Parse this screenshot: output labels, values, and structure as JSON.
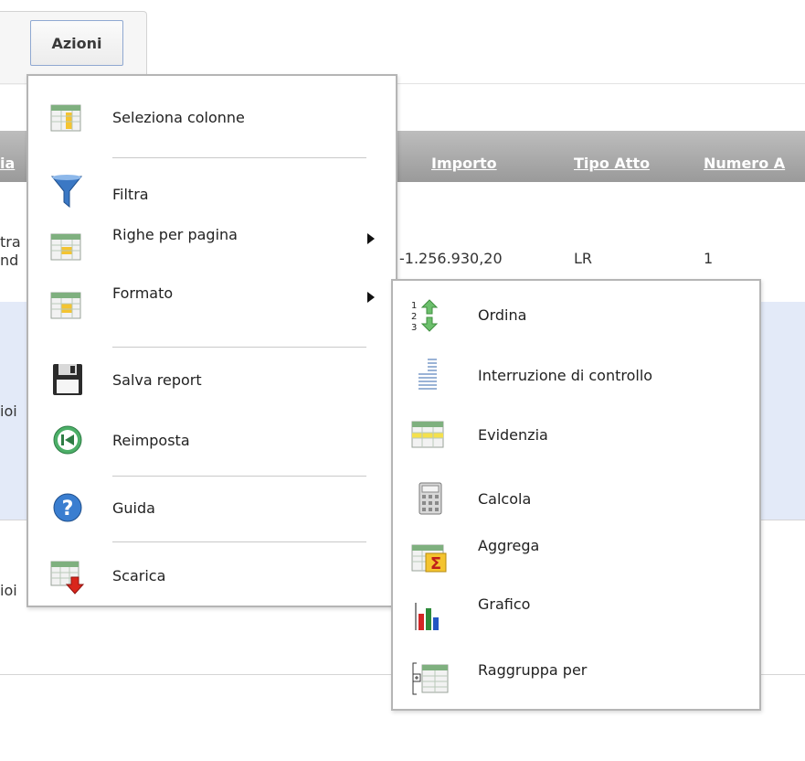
{
  "toolbar": {
    "actions_label": "Azioni"
  },
  "table": {
    "headers": [
      "ia",
      "Importo",
      "Tipo Atto",
      "Numero A"
    ],
    "row1": {
      "left_line1": "tra",
      "left_line2": "nd",
      "importo": "-1.256.930,20",
      "tipo_atto": "LR",
      "numero": "1"
    },
    "row2": {
      "left": "ioi"
    },
    "row3": {
      "left": "ioi"
    }
  },
  "actions_menu": {
    "items": [
      {
        "label": "Seleziona colonne",
        "icon": "columns-icon"
      },
      {
        "label": "Filtra",
        "icon": "funnel-icon"
      },
      {
        "label": "Righe per pagina",
        "icon": "rows-table-icon",
        "submenu": true
      },
      {
        "label": "Formato",
        "icon": "format-table-icon",
        "submenu": true
      },
      {
        "label": "Salva report",
        "icon": "floppy-disk-icon"
      },
      {
        "label": "Reimposta",
        "icon": "reset-icon"
      },
      {
        "label": "Guida",
        "icon": "help-icon"
      },
      {
        "label": "Scarica",
        "icon": "download-icon"
      }
    ]
  },
  "format_submenu": {
    "items": [
      {
        "label": "Ordina",
        "icon": "sort-icon"
      },
      {
        "label": "Interruzione di controllo",
        "icon": "control-break-icon"
      },
      {
        "label": "Evidenzia",
        "icon": "highlight-icon"
      },
      {
        "label": "Calcola",
        "icon": "calculator-icon"
      },
      {
        "label": "Aggrega",
        "icon": "aggregate-sigma-icon"
      },
      {
        "label": "Grafico",
        "icon": "bar-chart-icon"
      },
      {
        "label": "Raggruppa per",
        "icon": "group-by-icon"
      }
    ]
  },
  "colors": {
    "header_gray": "#a8a8a8",
    "selected_row": "#e3eaf8",
    "menu_border": "#b5b5b5"
  }
}
